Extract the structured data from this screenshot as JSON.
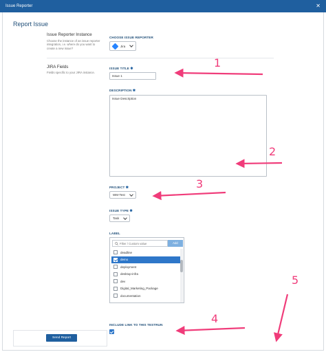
{
  "window": {
    "title": "Issue Reporter"
  },
  "page": {
    "title": "Report Issue"
  },
  "instance_section": {
    "title": "Issue Reporter Instance",
    "description": "Choose the instance of an issue reporter integration, i.e. where do you want to create a new issue?",
    "reporter_label": "CHOOSE ISSUE REPORTER",
    "reporter_value": "Jira"
  },
  "jira_section": {
    "title": "JIRA Fields",
    "description": "Fields specific to your JIRA instance."
  },
  "issue_title": {
    "label": "ISSUE TITLE",
    "value": "Issue 1"
  },
  "description": {
    "label": "DESCRIPTION",
    "value": "Issue Description"
  },
  "project": {
    "label": "PROJECT",
    "value": "WM-Test"
  },
  "issue_type": {
    "label": "ISSUE TYPE",
    "value": "Task"
  },
  "label_field": {
    "label": "LABEL",
    "filter_placeholder": "Filter / Custom value",
    "add_label": "Add",
    "options": [
      {
        "text": "deadline",
        "checked": false
      },
      {
        "text": "demo",
        "checked": true
      },
      {
        "text": "deployment",
        "checked": false
      },
      {
        "text": "desktop-infra",
        "checked": false
      },
      {
        "text": "dev",
        "checked": false
      },
      {
        "text": "Digital_Marketing_Package",
        "checked": false
      },
      {
        "text": "documentation",
        "checked": false
      }
    ]
  },
  "include_link": {
    "label": "INCLUDE LINK TO THIS TESTRUN",
    "checked": true
  },
  "footer": {
    "send_label": "Send Report"
  },
  "annotations": {
    "n1": "1",
    "n2": "2",
    "n3": "3",
    "n4": "4",
    "n5": "5"
  },
  "colors": {
    "primary": "#1f5f9f",
    "selected": "#2e77c9",
    "annotation": "#f03c7a"
  },
  "required_mark": "✱"
}
